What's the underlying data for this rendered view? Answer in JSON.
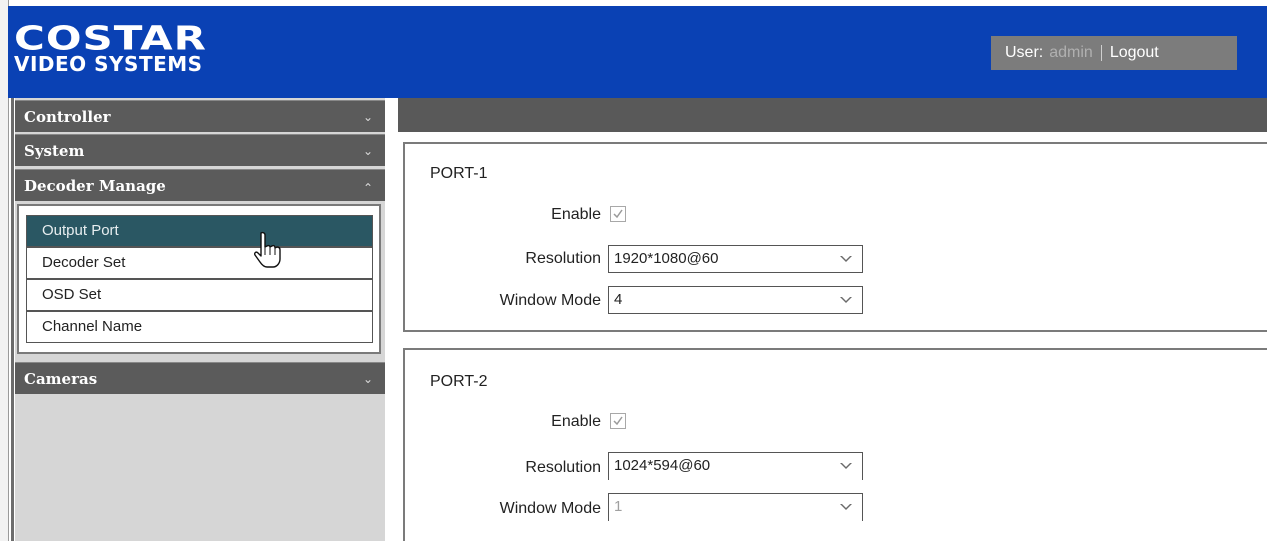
{
  "header": {
    "logo_line1": "COSTAR",
    "logo_line2": "VIDEO SYSTEMS",
    "user_label": "User:",
    "user_name": "admin",
    "logout_label": "Logout"
  },
  "sidebar": {
    "sections": [
      {
        "label": "Controller",
        "chevron": "chevron-down-icon"
      },
      {
        "label": "System",
        "chevron": "chevron-down-icon"
      },
      {
        "label": "Decoder Manage",
        "chevron": "chevron-up-icon"
      },
      {
        "label": "Cameras",
        "chevron": "chevron-down-icon"
      }
    ],
    "submenu": [
      {
        "label": "Output Port",
        "active": true
      },
      {
        "label": "Decoder Set"
      },
      {
        "label": "OSD Set"
      },
      {
        "label": "Channel Name"
      }
    ]
  },
  "ports": [
    {
      "title": "PORT-1",
      "enable_label": "Enable",
      "enabled": true,
      "resolution_label": "Resolution",
      "resolution_value": "1920*1080@60",
      "window_mode_label": "Window Mode",
      "window_mode_value": "4"
    },
    {
      "title": "PORT-2",
      "enable_label": "Enable",
      "enabled": true,
      "resolution_label": "Resolution",
      "resolution_value": "1024*594@60",
      "window_mode_label": "Window Mode",
      "window_mode_value": "1",
      "window_mode_disabled": true
    }
  ],
  "colors": {
    "header_bg": "#0a41b4",
    "section_bg": "#5b5b5b",
    "active_item_bg": "#2a5763"
  }
}
